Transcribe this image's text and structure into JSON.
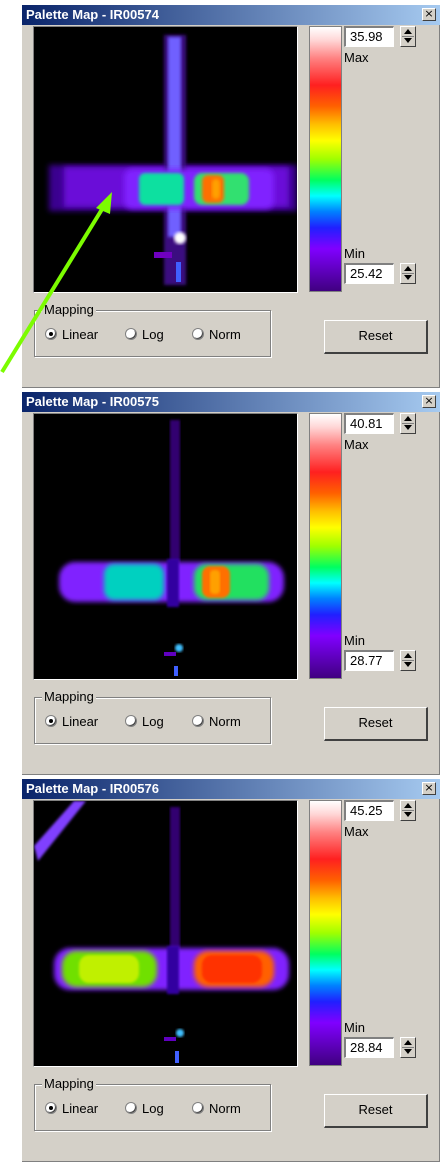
{
  "panels": [
    {
      "title": "Palette Map - IR00574",
      "max_value": "35.98",
      "min_value": "25.42",
      "max_label": "Max",
      "min_label": "Min",
      "mapping_label": "Mapping",
      "mapping_options": [
        "Linear",
        "Log",
        "Norm"
      ],
      "mapping_selected": "Linear",
      "reset_label": "Reset"
    },
    {
      "title": "Palette Map - IR00575",
      "max_value": "40.81",
      "min_value": "28.77",
      "max_label": "Max",
      "min_label": "Min",
      "mapping_label": "Mapping",
      "mapping_options": [
        "Linear",
        "Log",
        "Norm"
      ],
      "mapping_selected": "Linear",
      "reset_label": "Reset"
    },
    {
      "title": "Palette Map - IR00576",
      "max_value": "45.25",
      "min_value": "28.84",
      "max_label": "Max",
      "min_label": "Min",
      "mapping_label": "Mapping",
      "mapping_options": [
        "Linear",
        "Log",
        "Norm"
      ],
      "mapping_selected": "Linear",
      "reset_label": "Reset"
    }
  ],
  "icons": {
    "close": "close-icon",
    "spin": "spin-arrows-icon"
  },
  "colors": {
    "titlebar_start": "#0a246a",
    "titlebar_end": "#a6caf0",
    "panel_bg": "#d4d0c8",
    "annotation_arrow": "#7cfc00"
  }
}
